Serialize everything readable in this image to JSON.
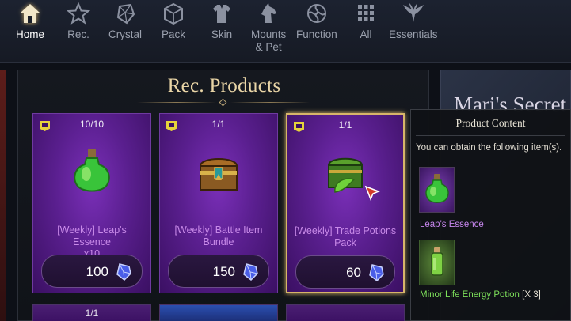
{
  "nav": {
    "items": [
      {
        "label": "Home",
        "icon": "home-icon",
        "active": true
      },
      {
        "label": "Rec.",
        "icon": "star-icon"
      },
      {
        "label": "Crystal",
        "icon": "crystal-icon"
      },
      {
        "label": "Pack",
        "icon": "pack-icon"
      },
      {
        "label": "Skin",
        "icon": "skin-icon"
      },
      {
        "label": "Mounts\n& Pet",
        "label_line1": "Mounts",
        "label_line2": "& Pet",
        "icon": "horse-icon"
      },
      {
        "label": "Function",
        "icon": "function-icon"
      },
      {
        "label": "All",
        "icon": "grid-icon"
      },
      {
        "label": "Essentials",
        "icon": "wings-icon"
      }
    ]
  },
  "panel": {
    "title": "Rec. Products",
    "products": [
      {
        "count": "10/10",
        "name": "[Weekly] Leap's Essence x10",
        "name_line1": "[Weekly] Leap's Essence",
        "name_line2": "x10",
        "price": "100",
        "item_icon": "green-potion-icon"
      },
      {
        "count": "1/1",
        "name": "[Weekly] Battle Item Bundle",
        "name_line1": "[Weekly] Battle Item",
        "name_line2": "Bundle",
        "price": "150",
        "item_icon": "treasure-chest-icon"
      },
      {
        "count": "1/1",
        "name": "[Weekly] Trade Potions Pack",
        "name_line1": "[Weekly] Trade Potions",
        "name_line2": "Pack",
        "price": "60",
        "item_icon": "green-chest-icon",
        "selected": true
      }
    ],
    "next_row_count": "1/1"
  },
  "banner": {
    "title": "Mari's Secret"
  },
  "popup": {
    "title": "Product Content",
    "description": "You can obtain the following item(s).",
    "items": [
      {
        "name": "Leap's Essence",
        "icon": "green-potion-icon",
        "rarity_color": "#c887ef"
      },
      {
        "name": "Minor Life Energy Potion",
        "quantity": "[X 3]",
        "icon": "small-potion-icon",
        "rarity_color": "#7de05a"
      }
    ]
  },
  "colors": {
    "card_purple": "#5a1f8f",
    "selected_border": "#d7b56a",
    "title_gold": "#e9d5a6",
    "name_purple": "#c88ae8"
  }
}
